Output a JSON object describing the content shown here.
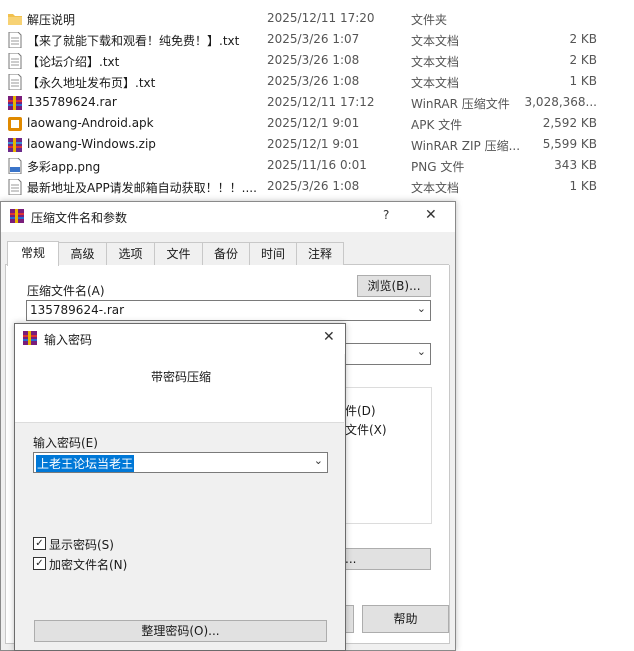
{
  "files": [
    {
      "name": "解压说明",
      "date": "2025/12/11 17:20",
      "type": "文件夹",
      "size": "",
      "icon": "folder-icon"
    },
    {
      "name": "【来了就能下载和观看！纯免费！】.txt",
      "date": "2025/3/26 1:07",
      "type": "文本文档",
      "size": "2 KB",
      "icon": "text-file-icon"
    },
    {
      "name": "【论坛介绍】.txt",
      "date": "2025/3/26 1:08",
      "type": "文本文档",
      "size": "2 KB",
      "icon": "text-file-icon"
    },
    {
      "name": "【永久地址发布页】.txt",
      "date": "2025/3/26 1:08",
      "type": "文本文档",
      "size": "1 KB",
      "icon": "text-file-icon"
    },
    {
      "name": "135789624.rar",
      "date": "2025/12/11 17:12",
      "type": "WinRAR 压缩文件",
      "size": "3,028,368...",
      "icon": "winrar-icon"
    },
    {
      "name": "laowang-Android.apk",
      "date": "2025/12/1 9:01",
      "type": "APK 文件",
      "size": "2,592 KB",
      "icon": "apk-icon"
    },
    {
      "name": "laowang-Windows.zip",
      "date": "2025/12/1 9:01",
      "type": "WinRAR ZIP 压缩...",
      "size": "5,599 KB",
      "icon": "winrar-zip-icon"
    },
    {
      "name": "多彩app.png",
      "date": "2025/11/16 0:01",
      "type": "PNG 文件",
      "size": "343 KB",
      "icon": "png-file-icon"
    },
    {
      "name": "最新地址及APP请发邮箱自动获取！！！....",
      "date": "2025/3/26 1:08",
      "type": "文本文档",
      "size": "1 KB",
      "icon": "text-file-icon"
    }
  ],
  "archive_dialog": {
    "title": "压缩文件名和参数",
    "help_glyph": "?",
    "close_glyph": "✕",
    "tabs": [
      "常规",
      "高级",
      "选项",
      "文件",
      "备份",
      "时间",
      "注释"
    ],
    "archive_name_label": "压缩文件名(A)",
    "browse_button": "浏览(B)...",
    "archive_name_value": "135789624-.rar",
    "partial_option_1": "件(D)",
    "partial_option_2": "文件(X)",
    "partial_button": "...",
    "help_button": "帮助"
  },
  "password_dialog": {
    "title": "输入密码",
    "close_glyph": "✕",
    "heading": "带密码压缩",
    "password_label": "输入密码(E)",
    "password_value": "上老王论坛当老王",
    "show_password_label": "显示密码(S)",
    "encrypt_names_label": "加密文件名(N)",
    "show_password_checked": "✓",
    "encrypt_names_checked": "✓",
    "organize_button": "整理密码(O)..."
  }
}
